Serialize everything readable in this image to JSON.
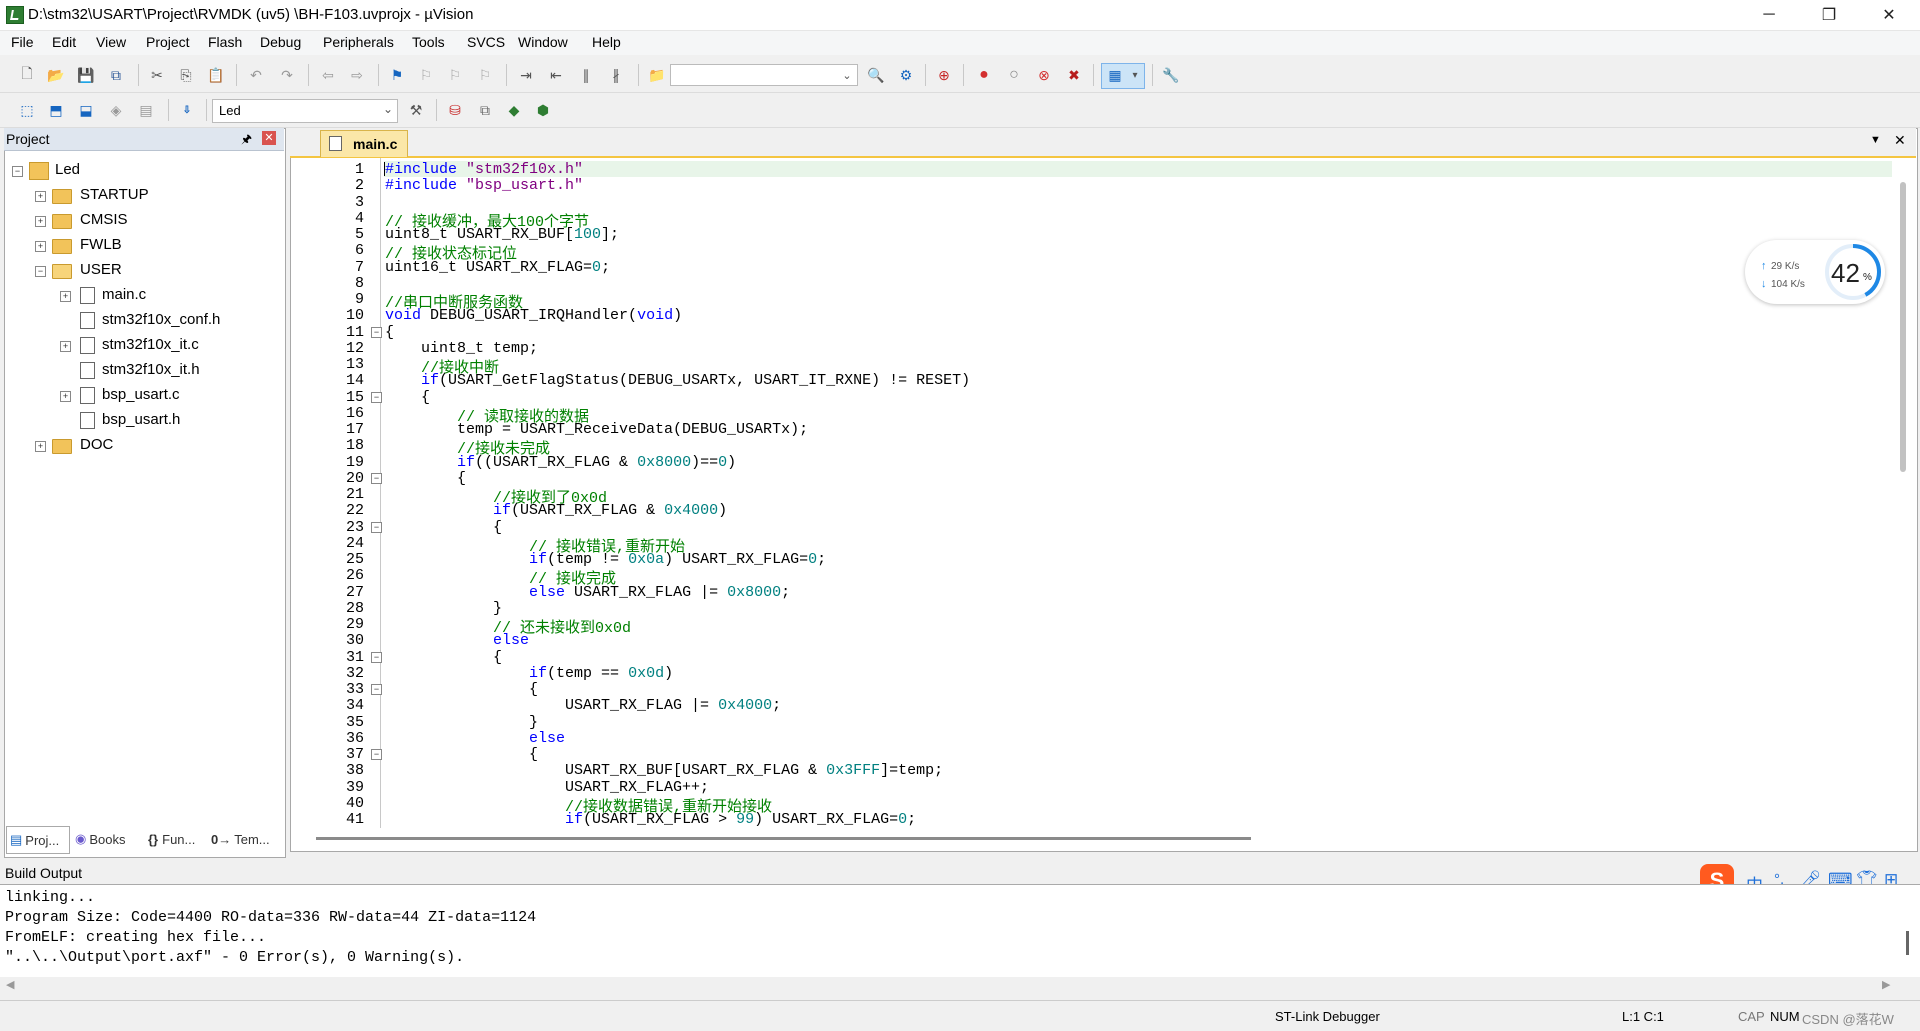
{
  "window": {
    "title": "D:\\stm32\\USART\\Project\\RVMDK  (uv5)  \\BH-F103.uvprojx - µVision",
    "controls": {
      "minimize": "─",
      "restore": "❐",
      "close": "✕"
    }
  },
  "menu": [
    "File",
    "Edit",
    "View",
    "Project",
    "Flash",
    "Debug",
    "Peripherals",
    "Tools",
    "SVCS",
    "Window",
    "Help"
  ],
  "toolbar2": {
    "target": "Led"
  },
  "project_panel": {
    "title": "Project",
    "pin": "ㅍ",
    "root": "Led",
    "groups": [
      {
        "label": "STARTUP",
        "expanded": false
      },
      {
        "label": "CMSIS",
        "expanded": false
      },
      {
        "label": "FWLB",
        "expanded": false
      },
      {
        "label": "USER",
        "expanded": true,
        "files": [
          "main.c",
          "stm32f10x_conf.h",
          "stm32f10x_it.c",
          "stm32f10x_it.h",
          "bsp_usart.c",
          "bsp_usart.h"
        ]
      },
      {
        "label": "DOC",
        "expanded": false
      }
    ],
    "bottom_tabs": [
      "Proj...",
      "Books",
      "Fun...",
      "Tem..."
    ]
  },
  "editor": {
    "tab": "main.c",
    "lines": [
      "#include \"stm32f10x.h\"",
      "#include \"bsp_usart.h\"",
      "",
      "// 接收缓冲，最大100个字节",
      "uint8_t USART_RX_BUF[100];",
      "// 接收状态标记位",
      "uint16_t USART_RX_FLAG=0;",
      "",
      "//串口中断服务函数",
      "void DEBUG_USART_IRQHandler(void)",
      "{",
      "    uint8_t temp;",
      "    //接收中断",
      "    if(USART_GetFlagStatus(DEBUG_USARTx, USART_IT_RXNE) != RESET)",
      "    {",
      "        // 读取接收的数据",
      "        temp = USART_ReceiveData(DEBUG_USARTx);",
      "        //接收未完成",
      "        if((USART_RX_FLAG & 0x8000)==0)",
      "        {",
      "            //接收到了0x0d",
      "            if(USART_RX_FLAG & 0x4000)",
      "            {",
      "                // 接收错误,重新开始",
      "                if(temp != 0x0a) USART_RX_FLAG=0;",
      "                // 接收完成",
      "                else USART_RX_FLAG |= 0x8000;",
      "            }",
      "            // 还未接收到0x0d",
      "            else",
      "            {",
      "                if(temp == 0x0d)",
      "                {",
      "                    USART_RX_FLAG |= 0x4000;",
      "                }",
      "                else",
      "                {",
      "                    USART_RX_BUF[USART_RX_FLAG & 0x3FFF]=temp;",
      "                    USART_RX_FLAG++;",
      "                    //接收数据错误,重新开始接收",
      "                    if(USART_RX_FLAG > 99) USART_RX_FLAG=0;"
    ]
  },
  "net_widget": {
    "up": "29  K/s",
    "down": "104  K/s",
    "percent": "42",
    "percent_unit": "%"
  },
  "build_output": {
    "title": "Build Output",
    "lines": [
      "linking...",
      "Program Size: Code=4400 RO-data=336 RW-data=44 ZI-data=1124",
      "FromELF: creating hex file...",
      "\"..\\..\\Output\\port.axf\" - 0 Error(s), 0 Warning(s)."
    ]
  },
  "ime": {
    "lang": "中",
    "punct": "°,"
  },
  "status_bar": {
    "debugger": "ST-Link Debugger",
    "position": "L:1 C:1",
    "caps": "CAP",
    "num": "NUM",
    "watermark": "CSDN @落花W"
  }
}
